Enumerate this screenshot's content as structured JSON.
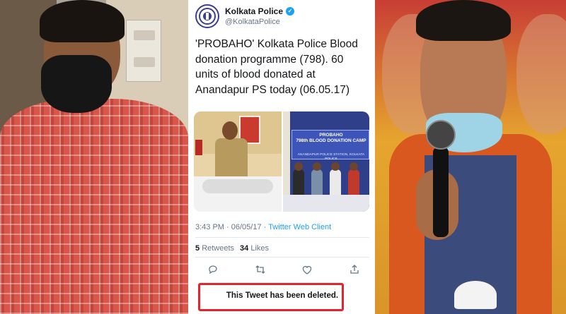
{
  "tweet": {
    "account_name": "Kolkata Police",
    "handle": "@KolkataPolice",
    "text": "'PROBAHO' Kolkata Police Blood donation programme (798). 60 units of blood donated at Anandapur PS today (06.05.17)",
    "media_banner_title": "PROBAHO\n798th BLOOD DONATION CAMP",
    "media_banner_sub": "ANANDAPUR POLICE STATION, KOLKATA POLICE",
    "time": "3:43 PM",
    "date": "06/05/17",
    "client": "Twitter Web Client",
    "retweets_count": "5",
    "retweets_label": "Retweets",
    "likes_count": "34",
    "likes_label": "Likes",
    "deleted_notice": "This Tweet has been deleted."
  },
  "icons": {
    "verified": "verified-badge-icon",
    "reply": "reply-icon",
    "retweet": "retweet-icon",
    "like": "heart-icon",
    "share": "share-icon"
  },
  "colors": {
    "twitter_blue": "#1da1f2",
    "highlight_red": "#e5232b"
  }
}
